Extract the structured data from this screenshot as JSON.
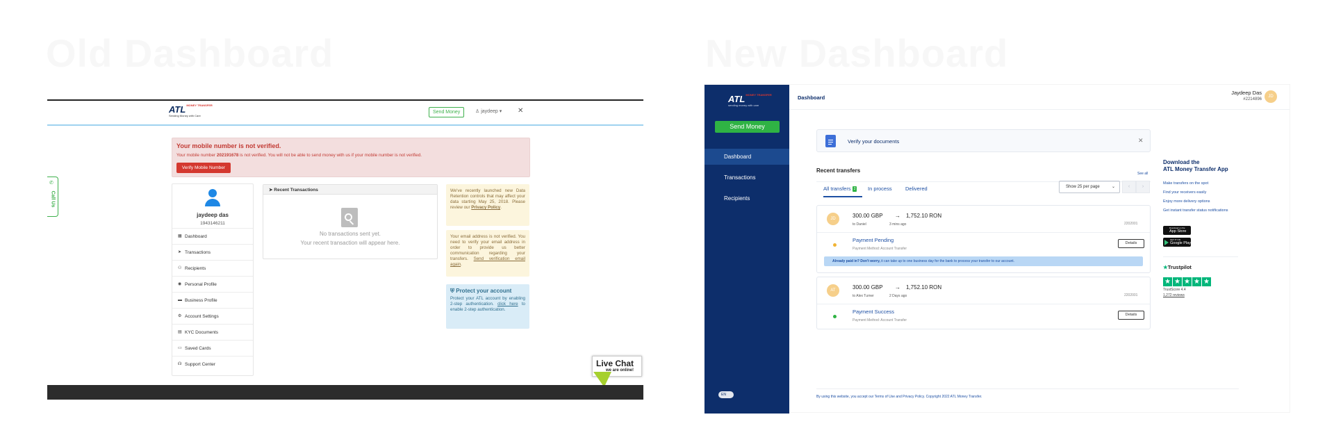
{
  "old": {
    "heading": "Old Dashboard",
    "logo": {
      "main": "ATL",
      "sup": "MONEY TRANSFER",
      "tagline": "Sending Money with Care"
    },
    "header": {
      "send_money": "Send Money",
      "user": "jaydeep",
      "close": "✕"
    },
    "call_us": "Call Us",
    "alert": {
      "title": "Your mobile number is not verified.",
      "pre": "Your mobile number ",
      "number": "202191678",
      "post": " is not verified. You will not be able to send money with us if your mobile number is not verified.",
      "button": "Verify Mobile Number"
    },
    "profile": {
      "name": "jaydeep das",
      "id": "1943146211"
    },
    "menu": [
      "Dashboard",
      "Transactions",
      "Recipients",
      "Personal Profile",
      "Business Profile",
      "Account Settings",
      "KYC Documents",
      "Saved Cards",
      "Support Center"
    ],
    "recent": {
      "title": "Recent Transactions",
      "empty1": "No transactions sent yet.",
      "empty2": "Your recent transaction will appear here."
    },
    "notice1": {
      "text": "We've recently launched new Data Retention controls that may affect your data starting May 25, 2018. Please review our ",
      "link": "Privacy Policy",
      "end": "."
    },
    "notice2": {
      "text": "Your email address is not verified. You need to verify your email address in order to provide us better communication regarding your transfers. ",
      "link": "Send verification email again",
      "end": "."
    },
    "protect": {
      "title": "Protect your account",
      "text": "Protect your ATL account by enabling 2-step authentication. ",
      "link": "click here",
      "end": " to enable 2-step authentication."
    },
    "live_chat": {
      "title": "Live Chat",
      "sub": "we are online!"
    }
  },
  "new": {
    "heading": "New Dashboard",
    "logo": {
      "main": "ATL",
      "sup": "MONEY TRANSFER",
      "tagline": "sending money with care"
    },
    "send_money": "Send Money",
    "nav": [
      "Dashboard",
      "Transactions",
      "Recipients"
    ],
    "lang": "EN",
    "topbar": {
      "page": "Dashboard",
      "user": "Jaydeep Das",
      "user_id": "#2214896",
      "initials": "JD"
    },
    "verify": {
      "text": "Verify your documents",
      "close": "✕"
    },
    "recent": {
      "title": "Recent transfers",
      "see_all": "See all",
      "tabs": [
        {
          "label": "All transfers",
          "count": "2"
        },
        {
          "label": "In process"
        },
        {
          "label": "Delivered"
        }
      ],
      "per_page": "Show 25 per page"
    },
    "transfers": [
      {
        "initials": "JD",
        "send": "300.00 GBP",
        "arrow": "→",
        "receive": "1,752.10 RON",
        "to": "to Daniel",
        "time": "3 mins ago",
        "ref": "2202001",
        "status": "Payment Pending",
        "method": "Payment Method: Account Transfer",
        "details": "Details",
        "dot": "#f1b434",
        "note_bold": "Already paid in? Don't worry,",
        "note": " it can take up to one business day for the bank to process your transfer to our account."
      },
      {
        "initials": "AT",
        "send": "300.00 GBP",
        "arrow": "→",
        "receive": "1,752.10 RON",
        "to": "to Alex Turner",
        "time": "2 Days ago",
        "ref": "2202001",
        "status": "Payment Success",
        "method": "Payment Method: Account Transfer",
        "details": "Details",
        "dot": "#2fb344"
      }
    ],
    "app": {
      "title1": "Download the",
      "title2": "ATL Money Transfer App",
      "features": [
        "Make transfers on the spot",
        "Find your receivers easily",
        "Enjoy more delivery options",
        "Get instant transfer status notifications"
      ],
      "appstore_small": "Download on the",
      "appstore": "App Store",
      "gplay_small": "GET IT ON",
      "gplay": "Google Play"
    },
    "trustpilot": {
      "name": "Trustpilot",
      "score": "TrustScore 4.4",
      "reviews": "1,272 reviews",
      "stars": 5
    },
    "footer": "By using this website, you accept our Terms of Use and Privacy Policy. Copyright 2022 ATL Money Transfer."
  },
  "colors": {
    "navy": "#0d2e6b",
    "green": "#2fb344",
    "red": "#d4382f",
    "trustpilot": "#00b67a"
  }
}
